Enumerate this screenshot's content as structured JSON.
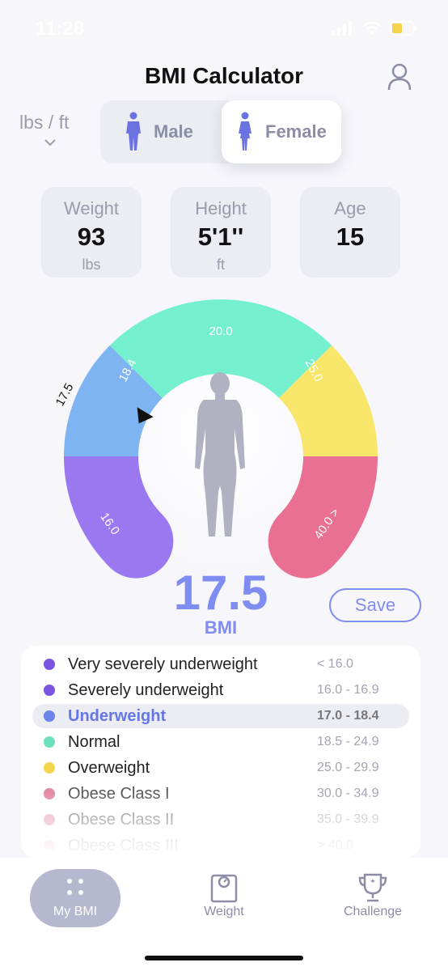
{
  "status_bar": {
    "time": "11:28"
  },
  "header": {
    "title": "BMI Calculator"
  },
  "unit_selector": {
    "value": "lbs / ft"
  },
  "gender_toggle": {
    "male_label": "Male",
    "female_label": "Female",
    "selected": "Female"
  },
  "stats": [
    {
      "label": "Weight",
      "value": "93",
      "unit": "lbs"
    },
    {
      "label": "Height",
      "value": "5'1''",
      "unit": "ft"
    },
    {
      "label": "Age",
      "value": "15",
      "unit": ""
    }
  ],
  "gauge": {
    "pointer_value": 17.5,
    "pointer_label": "17.5",
    "tick_labels": [
      "16.0",
      "18.4",
      "20.0",
      "25.0",
      "40.0 >"
    ],
    "colors": {
      "purple": "#9a78f0",
      "blue": "#7eb4f2",
      "green": "#75f0cf",
      "yellow": "#f8e66a",
      "pink": "#e96f93"
    }
  },
  "result": {
    "bmi": "17.5",
    "bmi_label": "BMI",
    "save_label": "Save",
    "accent": "#7f8cf0"
  },
  "legend": [
    {
      "name": "Very severely underweight",
      "range": "< 16.0",
      "color": "#7b55e0",
      "active": false
    },
    {
      "name": "Severely underweight",
      "range": "16.0 - 16.9",
      "color": "#7b55e0",
      "active": false
    },
    {
      "name": "Underweight",
      "range": "17.0 - 18.4",
      "color": "#6a84ec",
      "active": true
    },
    {
      "name": "Normal",
      "range": "18.5 - 24.9",
      "color": "#6fe0bf",
      "active": false
    },
    {
      "name": "Overweight",
      "range": "25.0 - 29.9",
      "color": "#f4d54e",
      "active": false
    },
    {
      "name": "Obese Class I",
      "range": "30.0 - 34.9",
      "color": "#e38aa3",
      "active": false
    },
    {
      "name": "Obese Class II",
      "range": "35.0 - 39.9",
      "color": "#eeb0c1",
      "active": false
    },
    {
      "name": "Obese Class III",
      "range": "> 40.0",
      "color": "#f4d3dc",
      "active": false
    }
  ],
  "tabs": [
    {
      "label": "My BMI",
      "active": true
    },
    {
      "label": "Weight",
      "active": false
    },
    {
      "label": "Challenge",
      "active": false
    }
  ]
}
